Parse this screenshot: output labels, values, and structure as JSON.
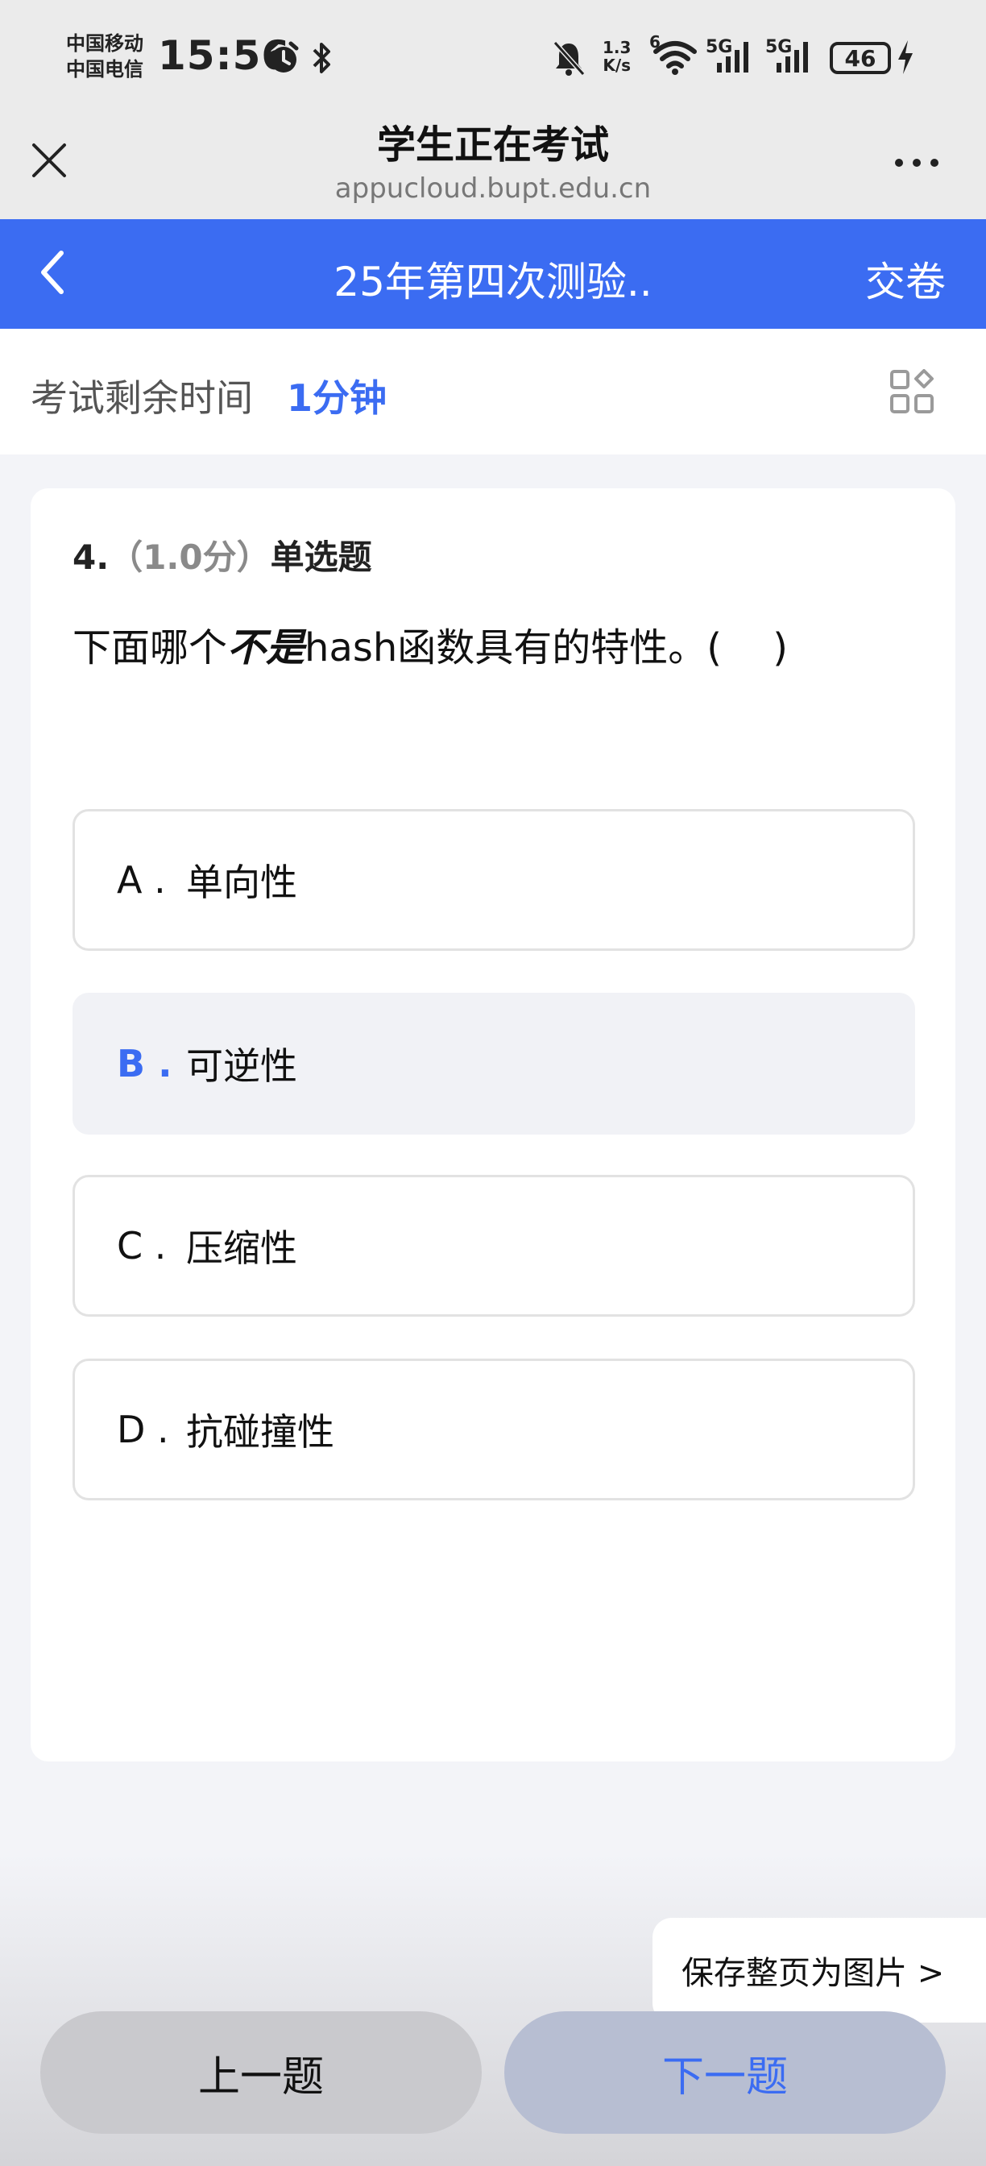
{
  "status_bar": {
    "carrier_1": "中国移动",
    "carrier_2": "中国电信",
    "time": "15:56",
    "net_speed_value": "1.3",
    "net_speed_unit": "K/s",
    "signal_1_label": "5G",
    "signal_2_label": "5G",
    "wifi_badge": "6",
    "battery": "46"
  },
  "web_header": {
    "title": "学生正在考试",
    "url": "appucloud.bupt.edu.cn"
  },
  "app_nav": {
    "title": "25年第四次测验..",
    "submit_label": "交卷"
  },
  "timer": {
    "label": "考试剩余时间",
    "value": "1分钟"
  },
  "question": {
    "number": "4.",
    "score": "（1.0分）",
    "type": "单选题",
    "text_before": "下面哪个",
    "text_emphasis": "不是",
    "text_after": "hash函数具有的特性。(　 )",
    "options": [
      {
        "letter": "A .",
        "text": "单向性",
        "selected": false
      },
      {
        "letter": "B .",
        "text": "可逆性",
        "selected": true
      },
      {
        "letter": "C .",
        "text": "压缩性",
        "selected": false
      },
      {
        "letter": "D .",
        "text": "抗碰撞性",
        "selected": false
      }
    ]
  },
  "save_image_label": "保存整页为图片 >",
  "buttons": {
    "prev": "上一题",
    "next": "下一题"
  },
  "colors": {
    "accent": "#3b6cf2",
    "status_bg": "#ebebeb",
    "page_bg": "#f3f4f8"
  }
}
